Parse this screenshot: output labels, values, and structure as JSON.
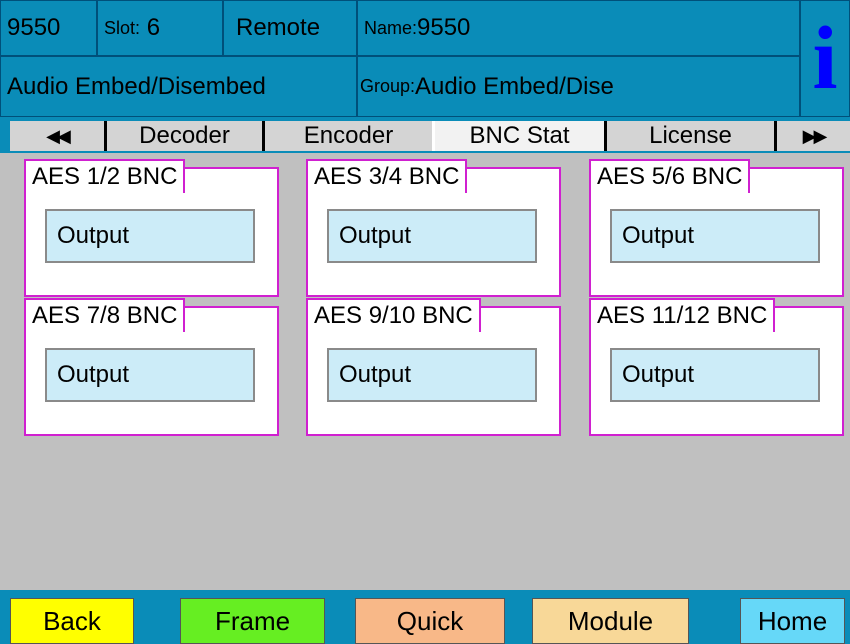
{
  "header": {
    "device": "9550",
    "slot_label": "Slot:",
    "slot_value": "6",
    "mode": "Remote",
    "name_label": "Name:",
    "name_value": "9550",
    "product": "Audio Embed/Disembed",
    "group_label": "Group:",
    "group_value": "Audio Embed/Dise",
    "info_glyph": "i"
  },
  "tabs": {
    "prev_arrow": "◀◀",
    "next_arrow": "▶▶",
    "items": [
      {
        "label": "Decoder"
      },
      {
        "label": "Encoder"
      },
      {
        "label": "BNC Stat"
      },
      {
        "label": "License"
      }
    ],
    "active": "BNC Stat"
  },
  "panels": [
    {
      "title": "AES 1/2 BNC",
      "value": "Output"
    },
    {
      "title": "AES 3/4 BNC",
      "value": "Output"
    },
    {
      "title": "AES 5/6 BNC",
      "value": "Output"
    },
    {
      "title": "AES 7/8 BNC",
      "value": "Output"
    },
    {
      "title": "AES 9/10 BNC",
      "value": "Output"
    },
    {
      "title": "AES 11/12 BNC",
      "value": "Output"
    }
  ],
  "footer": {
    "back": "Back",
    "frame": "Frame",
    "quick": "Quick",
    "module": "Module",
    "home": "Home"
  },
  "colors": {
    "header_bg": "#0a8cb8",
    "info_icon": "#0000ff",
    "panel_border": "#d020d0",
    "field_bg": "#ccecf8",
    "back": "#ffff00",
    "frame": "#66ee22",
    "quick": "#f8b888",
    "module": "#f8d898",
    "home": "#66d8f8"
  }
}
